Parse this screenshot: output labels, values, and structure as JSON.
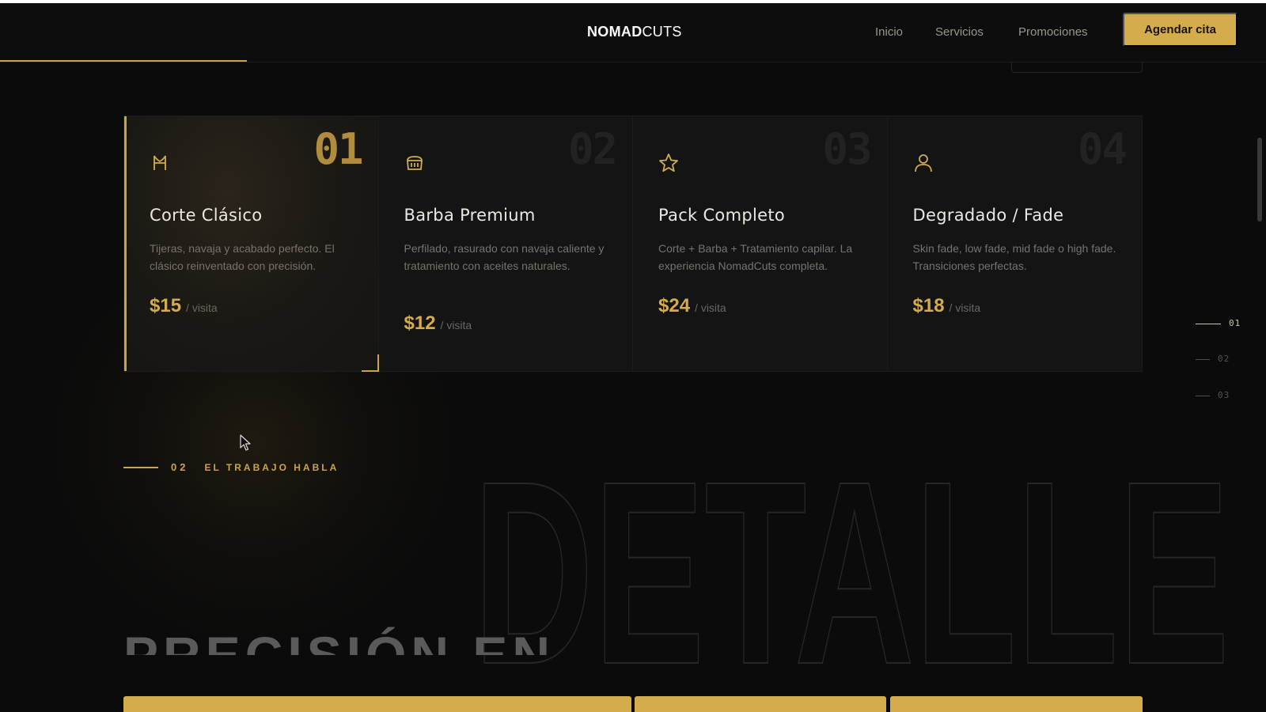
{
  "header": {
    "brand_bold": "NOMAD",
    "brand_light": "CUTS",
    "nav": [
      "Inicio",
      "Servicios",
      "Promociones"
    ],
    "cta_label": "Agendar cita"
  },
  "services": [
    {
      "num": "01",
      "icon": "scissors-icon",
      "title": "Corte Clásico",
      "desc": "Tijeras, navaja y acabado perfecto. El clásico reinventado con precisión.",
      "price": "$15",
      "unit": "/ visita",
      "active": true
    },
    {
      "num": "02",
      "icon": "bowl-icon",
      "title": "Barba Premium",
      "desc": "Perfilado, rasurado con navaja caliente y tratamiento con aceites naturales.",
      "price": "$12",
      "unit": "/ visita",
      "active": false
    },
    {
      "num": "03",
      "icon": "star-icon",
      "title": "Pack Completo",
      "desc": "Corte + Barba + Tratamiento capilar. La experiencia NomadCuts completa.",
      "price": "$24",
      "unit": "/ visita",
      "active": false
    },
    {
      "num": "04",
      "icon": "user-icon",
      "title": "Degradado / Fade",
      "desc": "Skin fade, low fade, mid fade o high fade. Transiciones perfectas.",
      "price": "$18",
      "unit": "/ visita",
      "active": false
    }
  ],
  "pager": [
    "01",
    "02",
    "03"
  ],
  "pager_active": "01",
  "section": {
    "num": "02",
    "label": "EL TRABAJO HABLA",
    "heading_partial": "PRECISIÓN EN",
    "outline_word": "DETALLE"
  },
  "colors": {
    "accent": "#d4ac4c",
    "background": "#0b0b0b",
    "card": "#141414"
  }
}
